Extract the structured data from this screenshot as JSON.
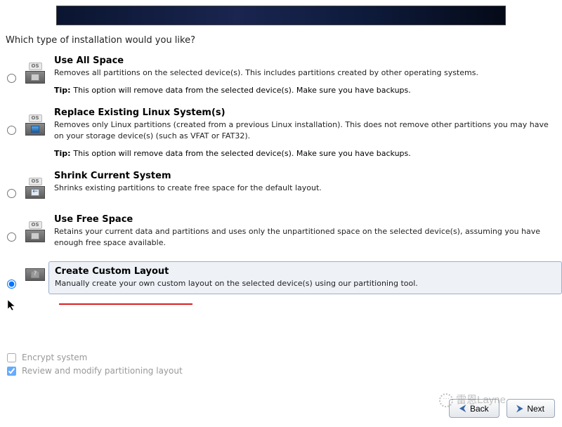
{
  "prompt": "Which type of installation would you like?",
  "options": [
    {
      "id": "use-all-space",
      "title": "Use All Space",
      "desc": "Removes all partitions on the selected device(s).  This includes partitions created by other operating systems.",
      "tip": "This option will remove data from the selected device(s).  Make sure you have backups.",
      "badge": "OS",
      "icon_variant": "plain",
      "selected": false
    },
    {
      "id": "replace-linux",
      "title": "Replace Existing Linux System(s)",
      "desc": "Removes only Linux partitions (created from a previous Linux installation).  This does not remove other partitions you may have on your storage device(s) (such as VFAT or FAT32).",
      "tip": "This option will remove data from the selected device(s).  Make sure you have backups.",
      "badge": "OS",
      "icon_variant": "blue",
      "selected": false
    },
    {
      "id": "shrink-system",
      "title": "Shrink Current System",
      "desc": "Shrinks existing partitions to create free space for the default layout.",
      "tip": "",
      "badge": "OS",
      "icon_variant": "arrow",
      "selected": false
    },
    {
      "id": "use-free-space",
      "title": "Use Free Space",
      "desc": "Retains your current data and partitions and uses only the unpartitioned space on the selected device(s), assuming you have enough free space available.",
      "tip": "",
      "badge": "OS",
      "icon_variant": "plain",
      "selected": false
    },
    {
      "id": "custom-layout",
      "title": "Create Custom Layout",
      "desc": "Manually create your own custom layout on the selected device(s) using our partitioning tool.",
      "tip": "",
      "badge": "",
      "icon_variant": "question",
      "selected": true
    }
  ],
  "tip_label": "Tip:",
  "checkboxes": {
    "encrypt_label": "Encrypt system",
    "encrypt_checked": false,
    "review_label": "Review and modify partitioning layout",
    "review_checked": true
  },
  "buttons": {
    "back": "Back",
    "next": "Next"
  },
  "watermark": "雷恩Layne"
}
